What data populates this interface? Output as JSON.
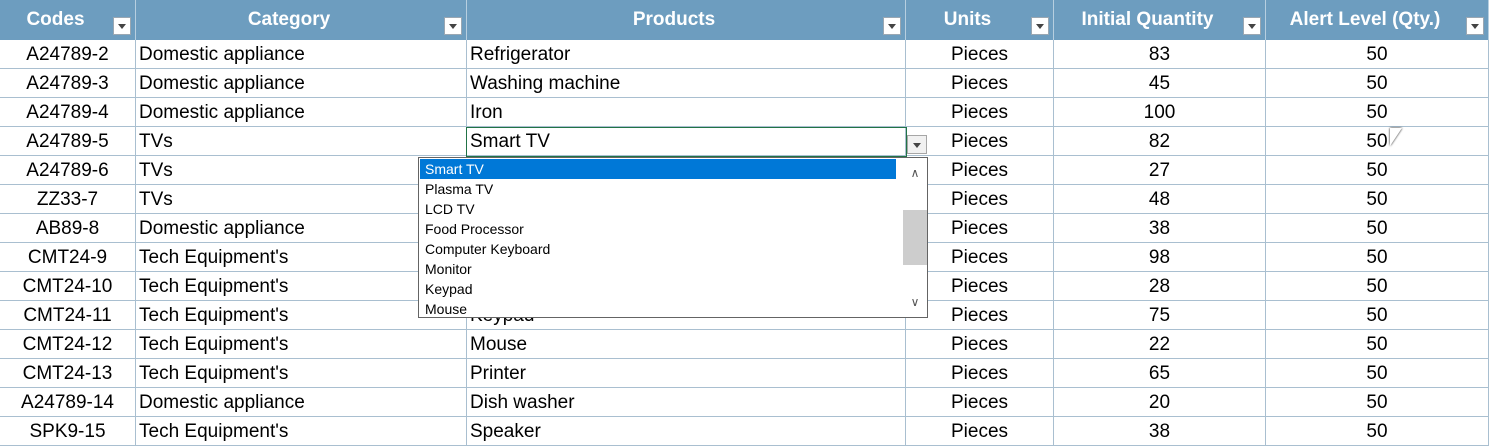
{
  "headers": [
    "Codes",
    "Category",
    "Products",
    "Units",
    "Initial Quantity",
    "Alert Level (Qty.)"
  ],
  "rows": [
    [
      "A24789-2",
      "Domestic appliance",
      "Refrigerator",
      "Pieces",
      "83",
      "50"
    ],
    [
      "A24789-3",
      "Domestic appliance",
      "Washing machine",
      "Pieces",
      "45",
      "50"
    ],
    [
      "A24789-4",
      "Domestic appliance",
      "Iron",
      "Pieces",
      "100",
      "50"
    ],
    [
      "A24789-5",
      "TVs",
      "Smart TV",
      "Pieces",
      "82",
      "50"
    ],
    [
      "A24789-6",
      "TVs",
      "",
      "Pieces",
      "27",
      "50"
    ],
    [
      "ZZ33-7",
      "TVs",
      "",
      "Pieces",
      "48",
      "50"
    ],
    [
      "AB89-8",
      "Domestic appliance",
      "",
      "Pieces",
      "38",
      "50"
    ],
    [
      "CMT24-9",
      "Tech Equipment's",
      "",
      "Pieces",
      "98",
      "50"
    ],
    [
      "CMT24-10",
      "Tech Equipment's",
      "",
      "Pieces",
      "28",
      "50"
    ],
    [
      "CMT24-11",
      "Tech Equipment's",
      "Keypad",
      "Pieces",
      "75",
      "50"
    ],
    [
      "CMT24-12",
      "Tech Equipment's",
      "Mouse",
      "Pieces",
      "22",
      "50"
    ],
    [
      "CMT24-13",
      "Tech Equipment's",
      "Printer",
      "Pieces",
      "65",
      "50"
    ],
    [
      "A24789-14",
      "Domestic appliance",
      "Dish washer",
      "Pieces",
      "20",
      "50"
    ],
    [
      "SPK9-15",
      "Tech Equipment's",
      "Speaker",
      "Pieces",
      "38",
      "50"
    ]
  ],
  "dropdown": {
    "options": [
      "Smart TV",
      "Plasma TV",
      "LCD TV",
      "Food Processor",
      "Computer Keyboard",
      "Monitor",
      "Keypad",
      "Mouse"
    ],
    "selected": "Smart TV"
  },
  "colors": {
    "header_bg": "#6d9dbf",
    "selection": "#0078d7",
    "active_border": "#217346"
  },
  "icons": [
    "filter-dropdown-icon",
    "chevron-up-icon",
    "chevron-down-icon",
    "mouse-cursor-icon"
  ]
}
